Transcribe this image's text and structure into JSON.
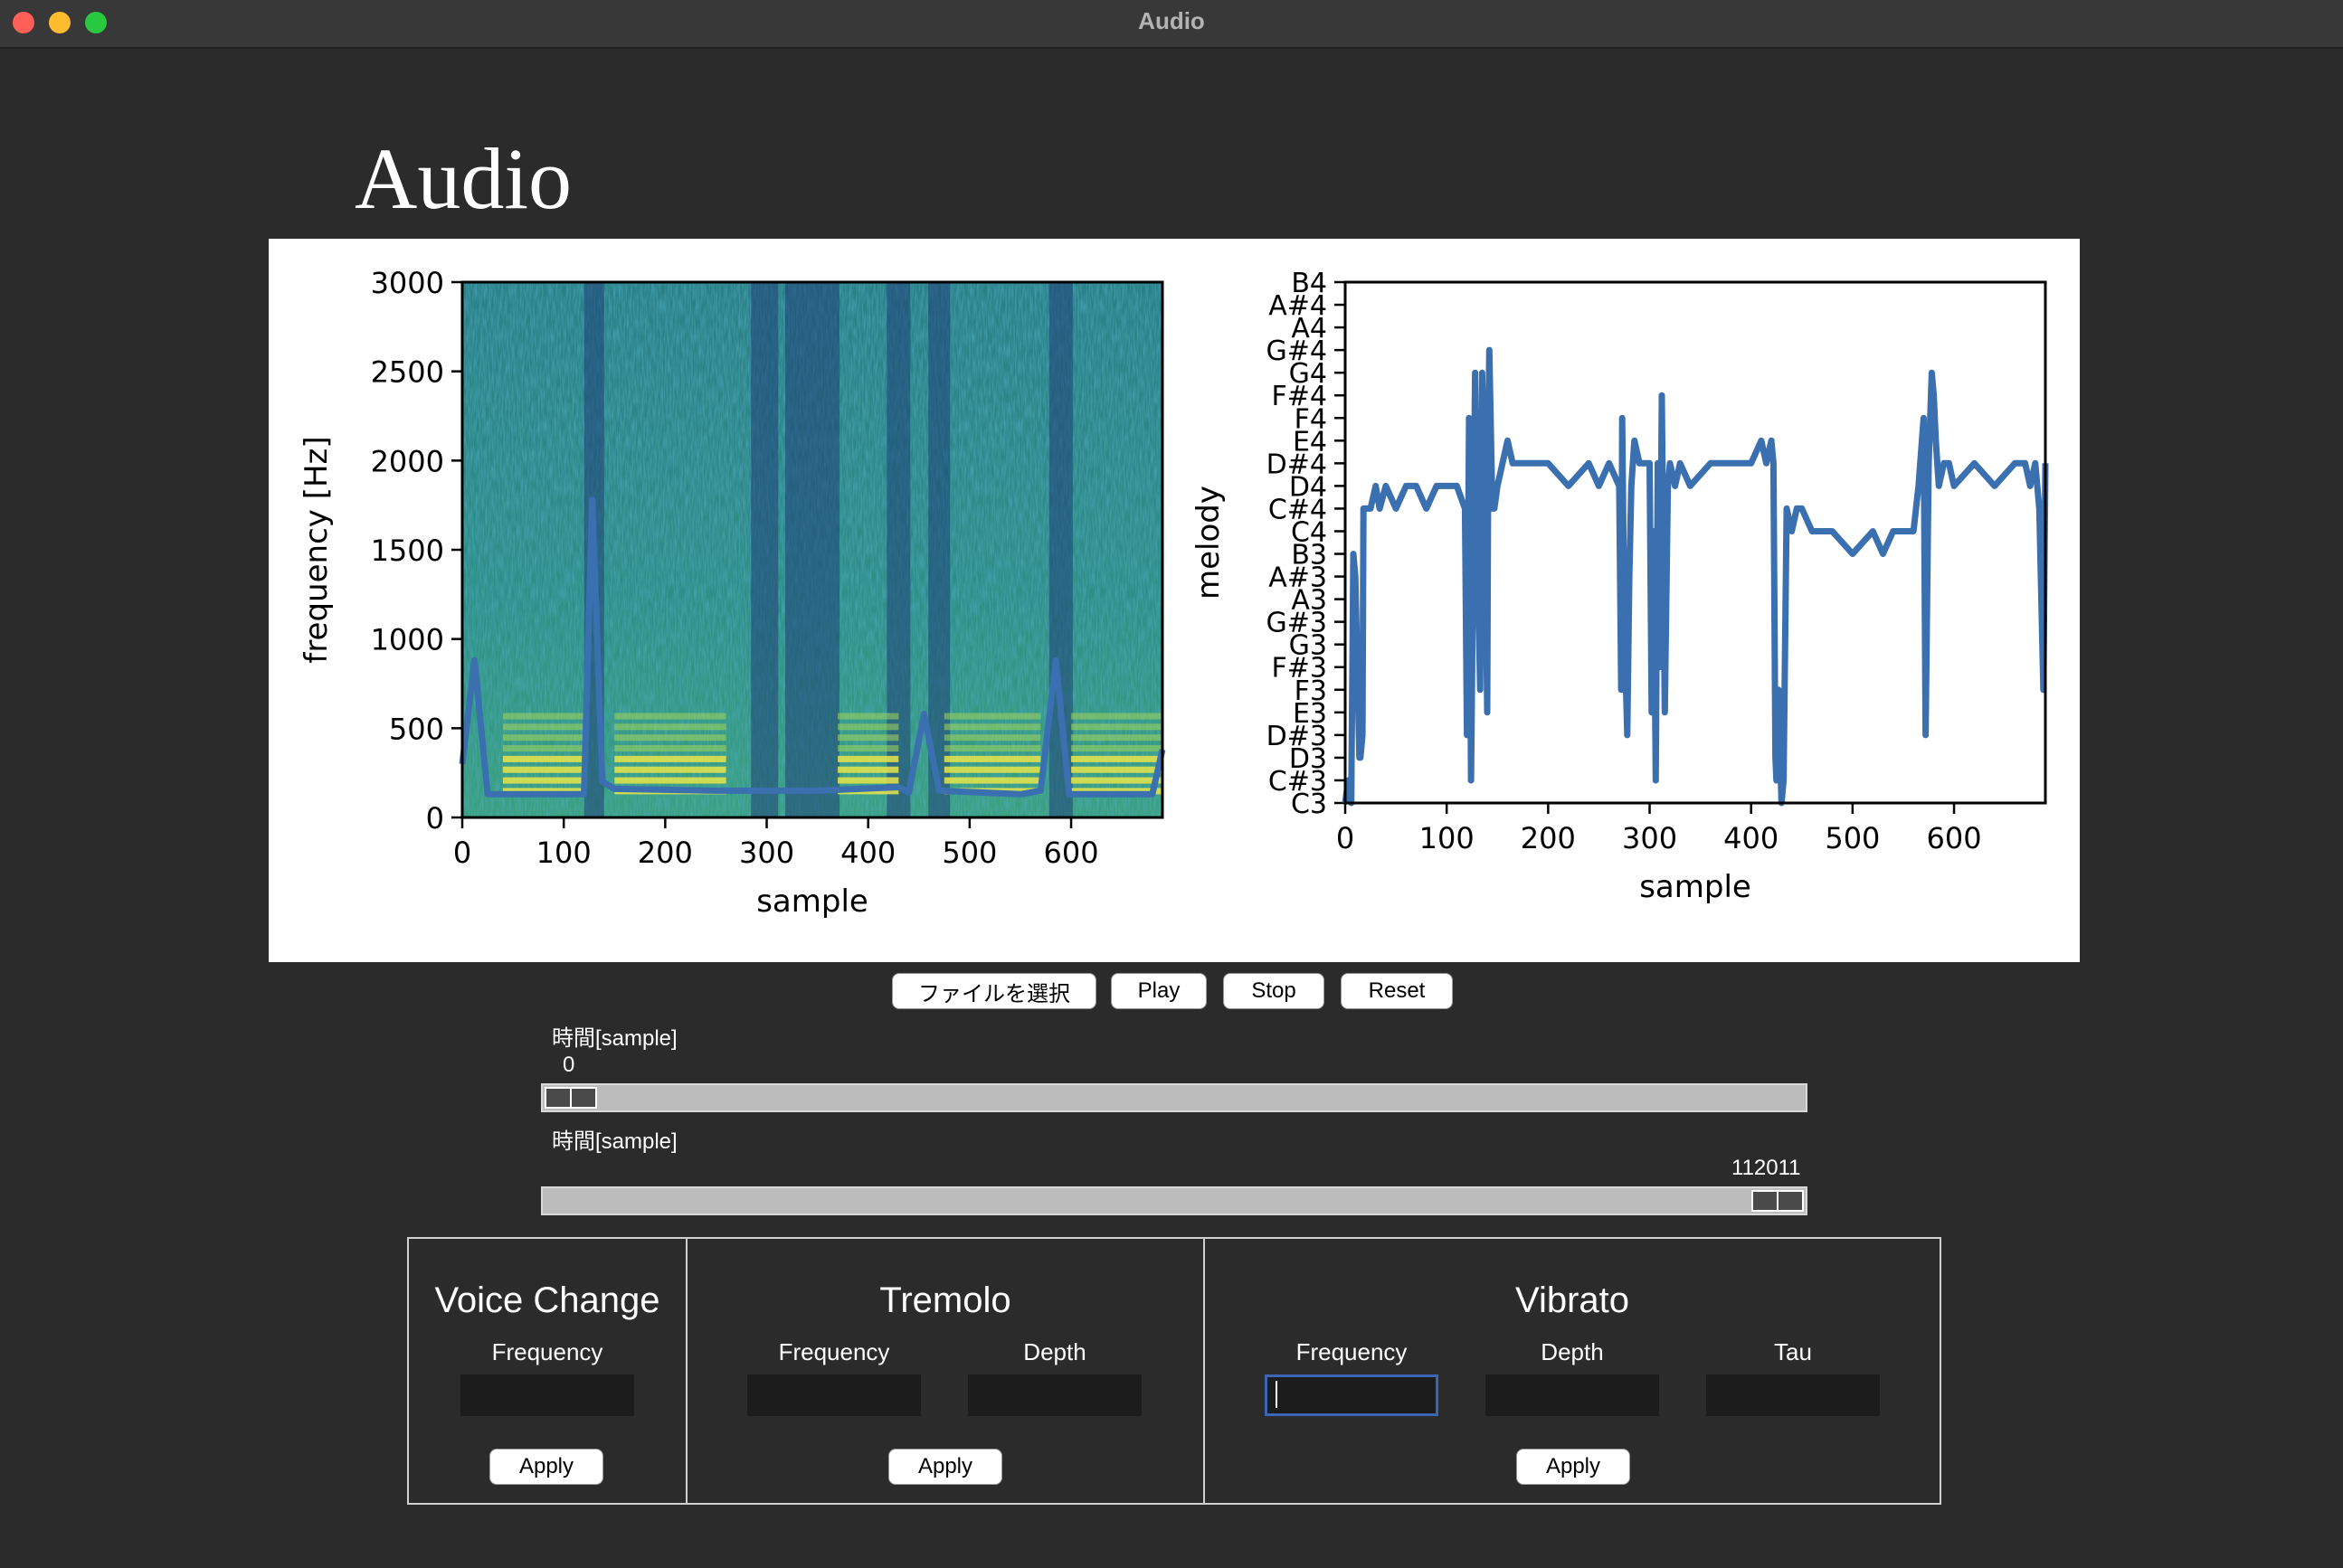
{
  "window": {
    "title": "Audio"
  },
  "page": {
    "heading": "Audio"
  },
  "toolbar": {
    "select_file": "ファイルを選択",
    "play": "Play",
    "stop": "Stop",
    "reset": "Reset"
  },
  "sliders": [
    {
      "label": "時間[sample]",
      "value": "0",
      "fraction": 0.0
    },
    {
      "label": "時間[sample]",
      "value": "112011",
      "fraction": 1.0
    }
  ],
  "effects": {
    "voice_change": {
      "title": "Voice Change",
      "frequency_label": "Frequency",
      "apply": "Apply"
    },
    "tremolo": {
      "title": "Tremolo",
      "frequency_label": "Frequency",
      "depth_label": "Depth",
      "apply": "Apply"
    },
    "vibrato": {
      "title": "Vibrato",
      "frequency_label": "Frequency",
      "depth_label": "Depth",
      "tau_label": "Tau",
      "apply": "Apply"
    }
  },
  "colors": {
    "line": "#3a6fb0",
    "background": "#2b2b2b",
    "focus": "#3a66b5"
  },
  "chart_data": [
    {
      "type": "heatmap",
      "title": "",
      "xlabel": "sample",
      "ylabel": "frequency [Hz]",
      "xlim": [
        0,
        690
      ],
      "ylim": [
        0,
        3000
      ],
      "xticks": [
        "0",
        "100",
        "200",
        "300",
        "400",
        "500",
        "600"
      ],
      "yticks": [
        "0",
        "500",
        "1000",
        "1500",
        "2000",
        "2500",
        "3000"
      ],
      "overlay": {
        "type": "line",
        "x": [
          0,
          12,
          25,
          40,
          120,
          128,
          138,
          150,
          250,
          350,
          430,
          440,
          455,
          470,
          550,
          570,
          585,
          598,
          610,
          680,
          690
        ],
        "y": [
          300,
          880,
          130,
          130,
          130,
          1780,
          200,
          160,
          150,
          150,
          170,
          140,
          580,
          150,
          130,
          150,
          880,
          130,
          130,
          130,
          380
        ]
      }
    },
    {
      "type": "line",
      "title": "",
      "xlabel": "sample",
      "ylabel": "melody",
      "xlim": [
        0,
        690
      ],
      "xticks": [
        "0",
        "100",
        "200",
        "300",
        "400",
        "500",
        "600"
      ],
      "yticks": [
        "C3",
        "C#3",
        "D3",
        "D#3",
        "E3",
        "F3",
        "F#3",
        "G3",
        "G#3",
        "A3",
        "A#3",
        "B3",
        "C4",
        "C#4",
        "D4",
        "D#4",
        "E4",
        "F4",
        "F#4",
        "G4",
        "G#4",
        "A4",
        "A#4",
        "B4"
      ],
      "series": [
        {
          "x": [
            0,
            3,
            6,
            8,
            10,
            14,
            15,
            17,
            18,
            22,
            25,
            30,
            34,
            40,
            50,
            60,
            70,
            80,
            90,
            100,
            110,
            118,
            120,
            122,
            124,
            128,
            130,
            133,
            135,
            138,
            140,
            141,
            142,
            145,
            147,
            150,
            155,
            160,
            165,
            170,
            175,
            180,
            190,
            200,
            220,
            240,
            250,
            260,
            270,
            272,
            273,
            275,
            278,
            280,
            282,
            285,
            290,
            295,
            300,
            302,
            304,
            306,
            308,
            310,
            312,
            315,
            318,
            320,
            325,
            330,
            340,
            360,
            380,
            400,
            410,
            415,
            420,
            422,
            424,
            425,
            427,
            430,
            432,
            435,
            440,
            445,
            450,
            460,
            470,
            480,
            500,
            520,
            530,
            540,
            550,
            560,
            565,
            570,
            572,
            575,
            578,
            580,
            582,
            585,
            590,
            595,
            600,
            620,
            640,
            660,
            670,
            675,
            680,
            684,
            688,
            690
          ],
          "y": [
            0,
            1,
            0,
            11,
            10,
            2,
            2,
            3,
            13,
            13,
            13,
            14,
            13,
            14,
            13,
            14,
            14,
            13,
            14,
            14,
            14,
            13,
            3,
            17,
            1,
            19,
            12,
            5,
            19,
            12,
            4,
            16,
            20,
            13,
            13,
            14,
            15,
            16,
            15,
            15,
            15,
            15,
            15,
            15,
            14,
            15,
            14,
            15,
            14,
            5,
            17,
            8,
            3,
            10,
            14,
            16,
            15,
            15,
            15,
            4,
            12,
            1,
            15,
            6,
            18,
            4,
            14,
            15,
            14,
            15,
            14,
            15,
            15,
            15,
            16,
            15,
            16,
            15,
            2,
            1,
            5,
            0,
            1,
            13,
            12,
            13,
            13,
            12,
            12,
            12,
            11,
            12,
            11,
            12,
            12,
            12,
            14,
            17,
            3,
            15,
            19,
            18,
            16,
            14,
            15,
            15,
            14,
            15,
            14,
            15,
            15,
            14,
            15,
            13,
            5,
            15
          ]
        }
      ]
    }
  ]
}
